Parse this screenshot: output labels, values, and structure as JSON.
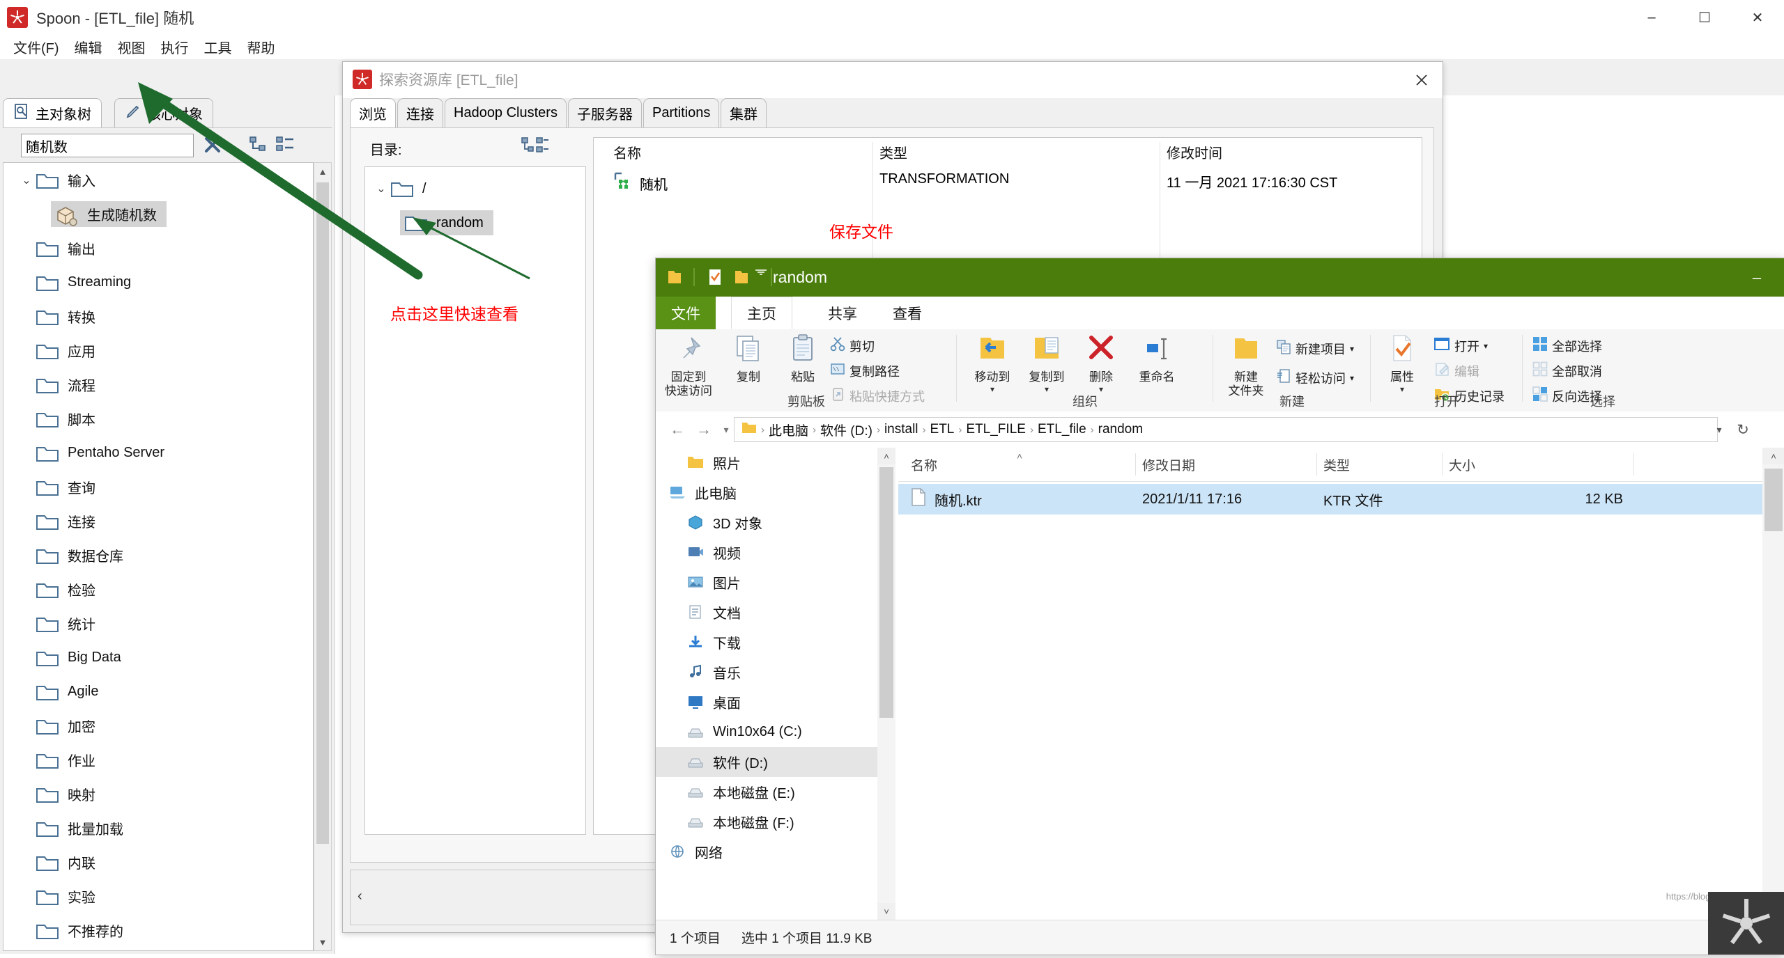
{
  "spoon": {
    "title": "Spoon - [ETL_file] 随机",
    "logo_icon": "spoon-logo-icon",
    "window_controls": {
      "minimize": "–",
      "maximize": "☐",
      "close": "✕"
    },
    "menu": [
      "文件(F)",
      "编辑",
      "视图",
      "执行",
      "工具",
      "帮助"
    ],
    "toolbar_icons": [
      "new-file-icon",
      "open-file-icon",
      "explore-repository-icon",
      "save-icon",
      "save-as-icon",
      "layers-icon",
      "dropdown-caret-icon"
    ],
    "active_doc_tab": "ETL_file",
    "highlight_color": "#ff0000",
    "arrow_color": "#1f6b2e"
  },
  "left_panel": {
    "tabs": [
      {
        "label": "主对象树",
        "icon": "object-tree-icon",
        "active": true
      },
      {
        "label": "核心对象",
        "icon": "core-objects-icon",
        "active": false
      }
    ],
    "search_value": "随机数",
    "search_placeholder": "",
    "clear_icon": "clear-x-icon",
    "collapse_icon": "collapse-all-icon",
    "expand_icon": "expand-all-icon",
    "tree": [
      {
        "label": "输入",
        "type": "folder",
        "expanded": true,
        "indent": 0
      },
      {
        "label": "生成随机数",
        "type": "step",
        "selected": true,
        "indent": 1
      },
      {
        "label": "输出",
        "type": "folder",
        "indent": 0
      },
      {
        "label": "Streaming",
        "type": "folder",
        "indent": 0
      },
      {
        "label": "转换",
        "type": "folder",
        "indent": 0
      },
      {
        "label": "应用",
        "type": "folder",
        "indent": 0
      },
      {
        "label": "流程",
        "type": "folder",
        "indent": 0
      },
      {
        "label": "脚本",
        "type": "folder",
        "indent": 0
      },
      {
        "label": "Pentaho Server",
        "type": "folder",
        "indent": 0
      },
      {
        "label": "查询",
        "type": "folder",
        "indent": 0
      },
      {
        "label": "连接",
        "type": "folder",
        "indent": 0
      },
      {
        "label": "数据仓库",
        "type": "folder",
        "indent": 0
      },
      {
        "label": "检验",
        "type": "folder",
        "indent": 0
      },
      {
        "label": "统计",
        "type": "folder",
        "indent": 0
      },
      {
        "label": "Big Data",
        "type": "folder",
        "indent": 0
      },
      {
        "label": "Agile",
        "type": "folder",
        "indent": 0
      },
      {
        "label": "加密",
        "type": "folder",
        "indent": 0
      },
      {
        "label": "作业",
        "type": "folder",
        "indent": 0
      },
      {
        "label": "映射",
        "type": "folder",
        "indent": 0
      },
      {
        "label": "批量加载",
        "type": "folder",
        "indent": 0
      },
      {
        "label": "内联",
        "type": "folder",
        "indent": 0
      },
      {
        "label": "实验",
        "type": "folder",
        "indent": 0
      },
      {
        "label": "不推荐的",
        "type": "folder",
        "indent": 0
      }
    ]
  },
  "repo_dialog": {
    "title": "探索资源库 [ETL_file]",
    "logo_icon": "spoon-logo-icon",
    "close_icon": "close-icon",
    "tabs": [
      {
        "label": "浏览",
        "active": true
      },
      {
        "label": "连接",
        "active": false
      },
      {
        "label": "Hadoop Clusters",
        "active": false
      },
      {
        "label": "子服务器",
        "active": false
      },
      {
        "label": "Partitions",
        "active": false
      },
      {
        "label": "集群",
        "active": false
      }
    ],
    "dir_label": "目录:",
    "dir_tools_icon": "tree-tools-icon",
    "tree": [
      {
        "label": "/",
        "indent": 0,
        "expanded": true,
        "selected": false
      },
      {
        "label": "random",
        "indent": 1,
        "selected": true
      }
    ],
    "columns": [
      "名称",
      "类型",
      "修改时间"
    ],
    "rows": [
      {
        "name": "随机",
        "icon": "transformation-icon",
        "type": "TRANSFORMATION",
        "modified": "11 一月 2021 17:16:30 CST"
      }
    ],
    "bottom_arrow": "‹"
  },
  "annotations": [
    {
      "text": "保存文件",
      "color": "#ff0000"
    },
    {
      "text": "点击这里快速查看",
      "color": "#ff0000"
    }
  ],
  "explorer": {
    "title": "random",
    "qat_icons": [
      "folder-icon",
      "properties-icon",
      "new-folder-icon",
      "qat-dropdown-icon"
    ],
    "minimize": "–",
    "ribbon_tabs": [
      {
        "label": "文件",
        "active": false,
        "kind": "file"
      },
      {
        "label": "主页",
        "active": true
      },
      {
        "label": "共享",
        "active": false
      },
      {
        "label": "查看",
        "active": false
      }
    ],
    "ribbon_groups": [
      {
        "label": "剪贴板",
        "big": [
          {
            "label": "固定到\n快速访问",
            "icon": "pin-icon"
          },
          {
            "label": "复制",
            "icon": "copy-icon"
          },
          {
            "label": "粘贴",
            "icon": "paste-icon"
          }
        ],
        "small": [
          {
            "label": "剪切",
            "icon": "cut-icon",
            "disabled": false
          },
          {
            "label": "复制路径",
            "icon": "copy-path-icon",
            "disabled": false
          },
          {
            "label": "粘贴快捷方式",
            "icon": "paste-shortcut-icon",
            "disabled": true
          }
        ]
      },
      {
        "label": "组织",
        "big": [
          {
            "label": "移动到",
            "icon": "move-to-icon",
            "caret": true
          },
          {
            "label": "复制到",
            "icon": "copy-to-icon",
            "caret": true
          },
          {
            "label": "删除",
            "icon": "delete-icon",
            "caret": true
          },
          {
            "label": "重命名",
            "icon": "rename-icon"
          }
        ],
        "small": []
      },
      {
        "label": "新建",
        "big": [
          {
            "label": "新建\n文件夹",
            "icon": "new-folder-icon"
          }
        ],
        "small": [
          {
            "label": "新建项目",
            "icon": "new-item-icon",
            "caret": true
          },
          {
            "label": "轻松访问",
            "icon": "easy-access-icon",
            "caret": true
          }
        ]
      },
      {
        "label": "打开",
        "big": [
          {
            "label": "属性",
            "icon": "properties-icon",
            "caret": true
          }
        ],
        "small": [
          {
            "label": "打开",
            "icon": "open-icon",
            "caret": true
          },
          {
            "label": "编辑",
            "icon": "edit-icon",
            "disabled": true
          },
          {
            "label": "历史记录",
            "icon": "history-icon"
          }
        ]
      },
      {
        "label": "选择",
        "big": [],
        "small": [
          {
            "label": "全部选择",
            "icon": "select-all-icon"
          },
          {
            "label": "全部取消",
            "icon": "select-none-icon"
          },
          {
            "label": "反向选择",
            "icon": "invert-selection-icon"
          }
        ]
      }
    ],
    "nav": {
      "back_icon": "back-arrow-icon",
      "forward_icon": "forward-arrow-icon",
      "recent_icon": "recent-caret-icon",
      "up_icon": "up-arrow-icon",
      "refresh_icon": "refresh-icon",
      "path_dropdown_icon": "path-dropdown-icon"
    },
    "breadcrumb": [
      "此电脑",
      "软件 (D:)",
      "install",
      "ETL",
      "ETL_FILE",
      "ETL_file",
      "random"
    ],
    "nav_pane": [
      {
        "label": "照片",
        "icon": "folder-icon",
        "indent": 1
      },
      {
        "label": "此电脑",
        "icon": "pc-icon",
        "indent": 0
      },
      {
        "label": "3D 对象",
        "icon": "3d-objects-icon",
        "indent": 1
      },
      {
        "label": "视频",
        "icon": "videos-icon",
        "indent": 1
      },
      {
        "label": "图片",
        "icon": "pictures-icon",
        "indent": 1
      },
      {
        "label": "文档",
        "icon": "documents-icon",
        "indent": 1
      },
      {
        "label": "下载",
        "icon": "downloads-icon",
        "indent": 1
      },
      {
        "label": "音乐",
        "icon": "music-icon",
        "indent": 1
      },
      {
        "label": "桌面",
        "icon": "desktop-icon",
        "indent": 1
      },
      {
        "label": "Win10x64 (C:)",
        "icon": "drive-icon",
        "indent": 1
      },
      {
        "label": "软件 (D:)",
        "icon": "drive-icon",
        "indent": 1,
        "selected": true
      },
      {
        "label": "本地磁盘 (E:)",
        "icon": "drive-icon",
        "indent": 1
      },
      {
        "label": "本地磁盘 (F:)",
        "icon": "drive-icon",
        "indent": 1
      },
      {
        "label": "网络",
        "icon": "network-icon",
        "indent": 0
      }
    ],
    "columns": [
      "名称",
      "修改日期",
      "类型",
      "大小"
    ],
    "files": [
      {
        "name": "随机.ktr",
        "icon": "generic-file-icon",
        "modified": "2021/1/11 17:16",
        "type": "KTR 文件",
        "size": "12 KB",
        "selected": true
      }
    ],
    "status": [
      "1 个项目",
      "选中 1 个项目 11.9 KB"
    ],
    "watermark": "https://blog.csdn.net/YKenan"
  }
}
